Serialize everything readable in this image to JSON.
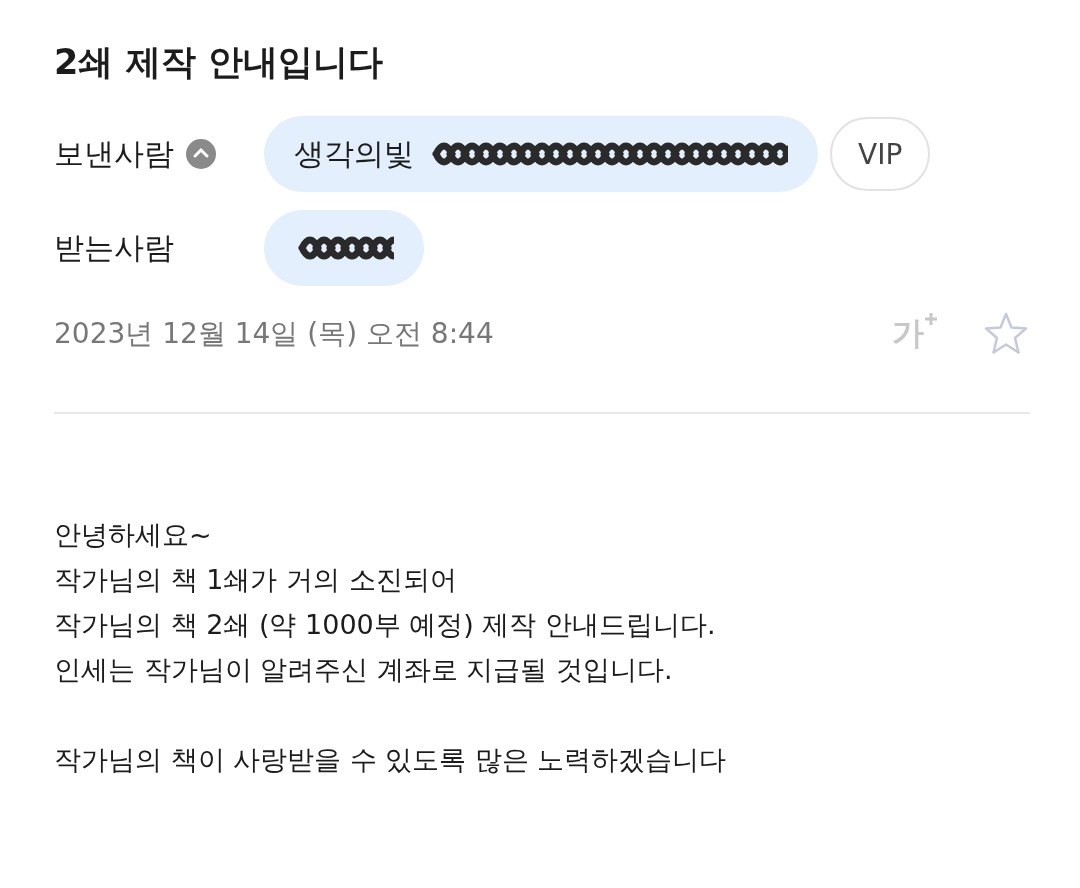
{
  "subject": "2쇄 제작 안내입니다",
  "sender": {
    "label": "보낸사람",
    "expanded": true,
    "name": "생각의빛",
    "vip": "VIP"
  },
  "recipient": {
    "label": "받는사람"
  },
  "date": "2023년 12월 14일 (목) 오전 8:44",
  "font_size_button": "가",
  "starred": false,
  "body": [
    [
      "안녕하세요~",
      "작가님의 책 1쇄가 거의 소진되어",
      "작가님의 책 2쇄 (약 1000부 예정) 제작 안내드립니다.",
      "인세는 작가님이 알려주신 계좌로 지급될 것입니다."
    ],
    [
      "작가님의 책이 사랑받을 수 있도록 많은 노력하겠습니다"
    ]
  ]
}
